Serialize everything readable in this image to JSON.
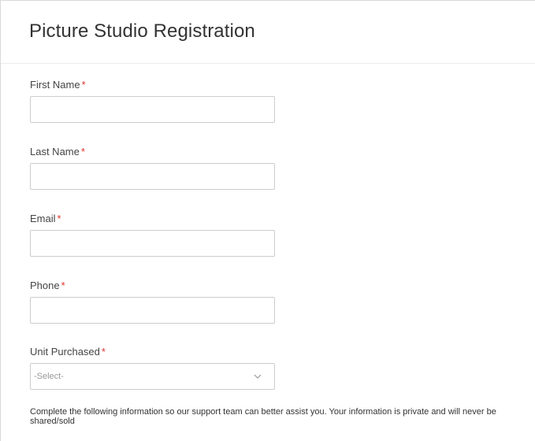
{
  "form": {
    "title": "Picture Studio Registration",
    "required_marker": "*",
    "fields": {
      "first_name": {
        "label": "First Name",
        "value": "",
        "placeholder": ""
      },
      "last_name": {
        "label": "Last Name",
        "value": "",
        "placeholder": ""
      },
      "email": {
        "label": "Email",
        "value": "",
        "placeholder": ""
      },
      "phone": {
        "label": "Phone",
        "value": "",
        "placeholder": ""
      },
      "unit_purchased": {
        "label": "Unit Purchased",
        "selected": "-Select-"
      }
    },
    "help_text": "Complete the following information so our support team can better assist you.  Your information is private and will never be shared/sold"
  },
  "colors": {
    "required": "#e0322c",
    "border": "#cccccc",
    "text": "#333333"
  },
  "icons": {
    "select_arrow": "chevron-down-icon"
  }
}
